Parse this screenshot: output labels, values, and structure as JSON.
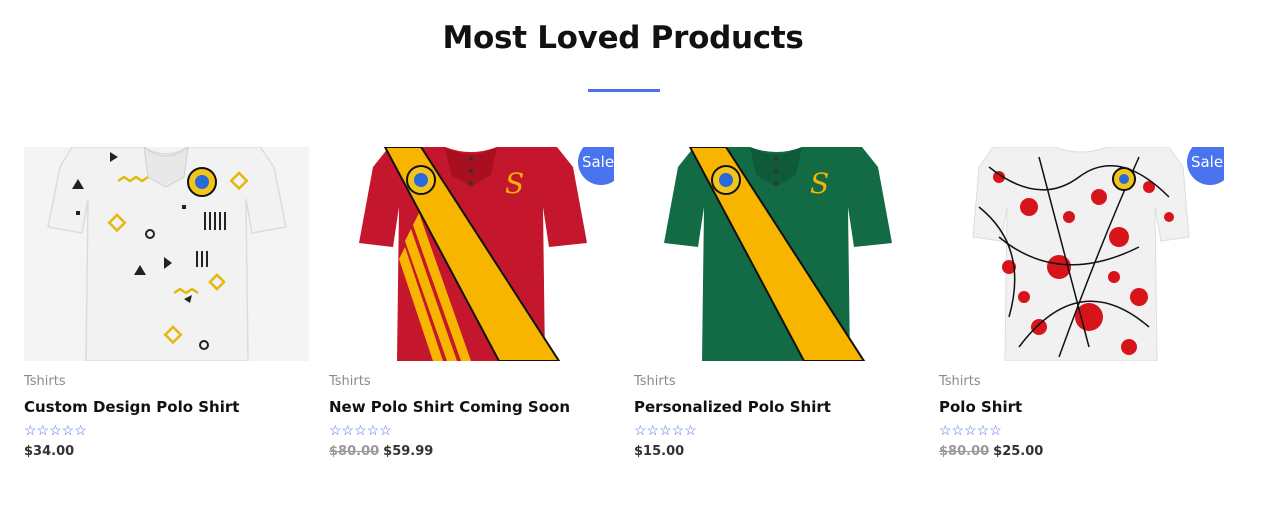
{
  "section": {
    "title": "Most Loved Products"
  },
  "colors": {
    "accent": "#4a6fe8",
    "sale_badge": "#4a73f0"
  },
  "products": [
    {
      "category": "Tshirts",
      "name": "Custom Design Polo Shirt",
      "rating_stars": "☆☆☆☆☆",
      "rating": 0,
      "price": "$34.00",
      "regular_price": "",
      "sale": false,
      "image_icon": "white-patterned-polo-shirt"
    },
    {
      "category": "Tshirts",
      "name": "New Polo Shirt Coming Soon",
      "rating_stars": "☆☆☆☆☆",
      "rating": 0,
      "price": "$59.99",
      "regular_price": "$80.00",
      "sale": true,
      "sale_label": "Sale!",
      "image_icon": "red-polo-shirt-yellow-sash"
    },
    {
      "category": "Tshirts",
      "name": "Personalized Polo Shirt",
      "rating_stars": "☆☆☆☆☆",
      "rating": 0,
      "price": "$15.00",
      "regular_price": "",
      "sale": false,
      "image_icon": "green-polo-shirt-yellow-sash"
    },
    {
      "category": "Tshirts",
      "name": "Polo Shirt",
      "rating_stars": "☆☆☆☆☆",
      "rating": 0,
      "price": "$25.00",
      "regular_price": "$80.00",
      "sale": true,
      "sale_label": "Sale!",
      "image_icon": "splatter-polo-shirt"
    }
  ]
}
